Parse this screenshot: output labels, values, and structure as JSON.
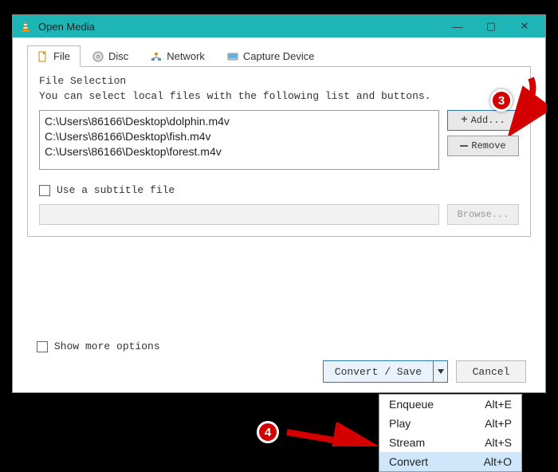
{
  "window": {
    "title": "Open Media"
  },
  "tabs": {
    "file": "File",
    "disc": "Disc",
    "network": "Network",
    "capture": "Capture Device"
  },
  "fileSelection": {
    "groupLabel": "File Selection",
    "help": "You can select local files with the following list and buttons.",
    "files": [
      "C:\\Users\\86166\\Desktop\\dolphin.m4v",
      "C:\\Users\\86166\\Desktop\\fish.m4v",
      "C:\\Users\\86166\\Desktop\\forest.m4v"
    ],
    "addLabel": "Add...",
    "removeLabel": "Remove"
  },
  "subtitle": {
    "checkboxLabel": "Use a subtitle file",
    "browseLabel": "Browse..."
  },
  "moreOptions": {
    "label": "Show more options"
  },
  "bottom": {
    "convertSave": "Convert / Save",
    "cancel": "Cancel"
  },
  "menu": {
    "items": [
      {
        "label": "Enqueue",
        "shortcut": "Alt+E"
      },
      {
        "label": "Play",
        "shortcut": "Alt+P"
      },
      {
        "label": "Stream",
        "shortcut": "Alt+S"
      },
      {
        "label": "Convert",
        "shortcut": "Alt+O"
      }
    ],
    "highlighted": 3
  },
  "annotations": {
    "badge3": "3",
    "badge4": "4"
  }
}
